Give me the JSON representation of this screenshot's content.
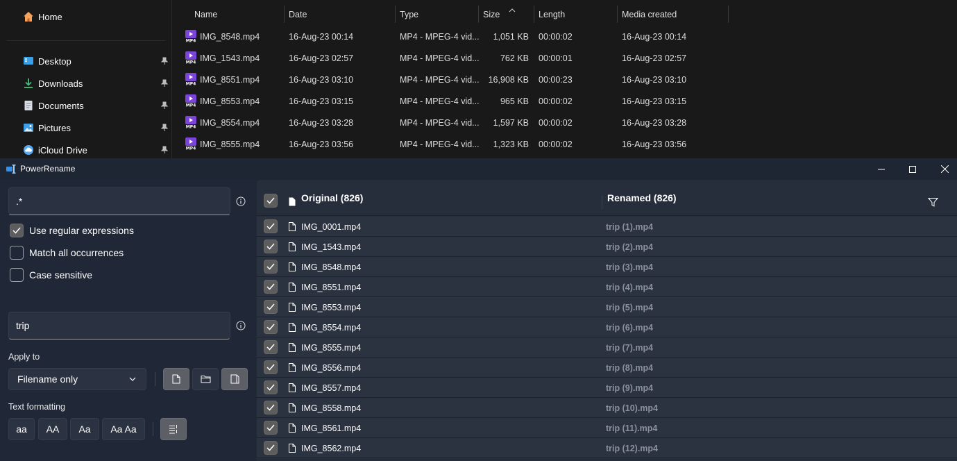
{
  "explorer": {
    "nav": {
      "home": "Home",
      "quick_access": [
        {
          "label": "Desktop",
          "icon": "desktop-icon"
        },
        {
          "label": "Downloads",
          "icon": "download-icon"
        },
        {
          "label": "Documents",
          "icon": "documents-icon"
        },
        {
          "label": "Pictures",
          "icon": "pictures-icon"
        },
        {
          "label": "iCloud Drive",
          "icon": "icloud-icon"
        }
      ]
    },
    "columns": {
      "name": "Name",
      "date": "Date",
      "type": "Type",
      "size": "Size",
      "length": "Length",
      "media_created": "Media created"
    },
    "files": [
      {
        "name": "IMG_8548.mp4",
        "date": "16-Aug-23 00:14",
        "type": "MP4 - MPEG-4 vid...",
        "size": "1,051 KB",
        "length": "00:00:02",
        "media_created": "16-Aug-23 00:14"
      },
      {
        "name": "IMG_1543.mp4",
        "date": "16-Aug-23 02:57",
        "type": "MP4 - MPEG-4 vid...",
        "size": "762 KB",
        "length": "00:00:01",
        "media_created": "16-Aug-23 02:57"
      },
      {
        "name": "IMG_8551.mp4",
        "date": "16-Aug-23 03:10",
        "type": "MP4 - MPEG-4 vid...",
        "size": "16,908 KB",
        "length": "00:00:23",
        "media_created": "16-Aug-23 03:10"
      },
      {
        "name": "IMG_8553.mp4",
        "date": "16-Aug-23 03:15",
        "type": "MP4 - MPEG-4 vid...",
        "size": "965 KB",
        "length": "00:00:02",
        "media_created": "16-Aug-23 03:15"
      },
      {
        "name": "IMG_8554.mp4",
        "date": "16-Aug-23 03:28",
        "type": "MP4 - MPEG-4 vid...",
        "size": "1,597 KB",
        "length": "00:00:02",
        "media_created": "16-Aug-23 03:28"
      },
      {
        "name": "IMG_8555.mp4",
        "date": "16-Aug-23 03:56",
        "type": "MP4 - MPEG-4 vid...",
        "size": "1,323 KB",
        "length": "00:00:02",
        "media_created": "16-Aug-23 03:56"
      }
    ]
  },
  "powerrename": {
    "title": "PowerRename",
    "search_value": ".*",
    "options": {
      "use_regex": {
        "label": "Use regular expressions",
        "checked": true
      },
      "match_all": {
        "label": "Match all occurrences",
        "checked": false
      },
      "case_sensitive": {
        "label": "Case sensitive",
        "checked": false
      }
    },
    "replace_value": "trip",
    "apply_to_label": "Apply to",
    "apply_to_value": "Filename only",
    "text_formatting_label": "Text formatting",
    "formatting_buttons": [
      "aa",
      "AA",
      "Aa",
      "Aa Aa"
    ],
    "list": {
      "original_header": "Original (826)",
      "renamed_header": "Renamed (826)",
      "rows": [
        {
          "original": "IMG_0001.mp4",
          "renamed": "trip (1).mp4"
        },
        {
          "original": "IMG_1543.mp4",
          "renamed": "trip (2).mp4"
        },
        {
          "original": "IMG_8548.mp4",
          "renamed": "trip (3).mp4"
        },
        {
          "original": "IMG_8551.mp4",
          "renamed": "trip (4).mp4"
        },
        {
          "original": "IMG_8553.mp4",
          "renamed": "trip (5).mp4"
        },
        {
          "original": "IMG_8554.mp4",
          "renamed": "trip (6).mp4"
        },
        {
          "original": "IMG_8555.mp4",
          "renamed": "trip (7).mp4"
        },
        {
          "original": "IMG_8556.mp4",
          "renamed": "trip (8).mp4"
        },
        {
          "original": "IMG_8557.mp4",
          "renamed": "trip (9).mp4"
        },
        {
          "original": "IMG_8558.mp4",
          "renamed": "trip (10).mp4"
        },
        {
          "original": "IMG_8561.mp4",
          "renamed": "trip (11).mp4"
        },
        {
          "original": "IMG_8562.mp4",
          "renamed": "trip (12).mp4"
        }
      ]
    }
  }
}
